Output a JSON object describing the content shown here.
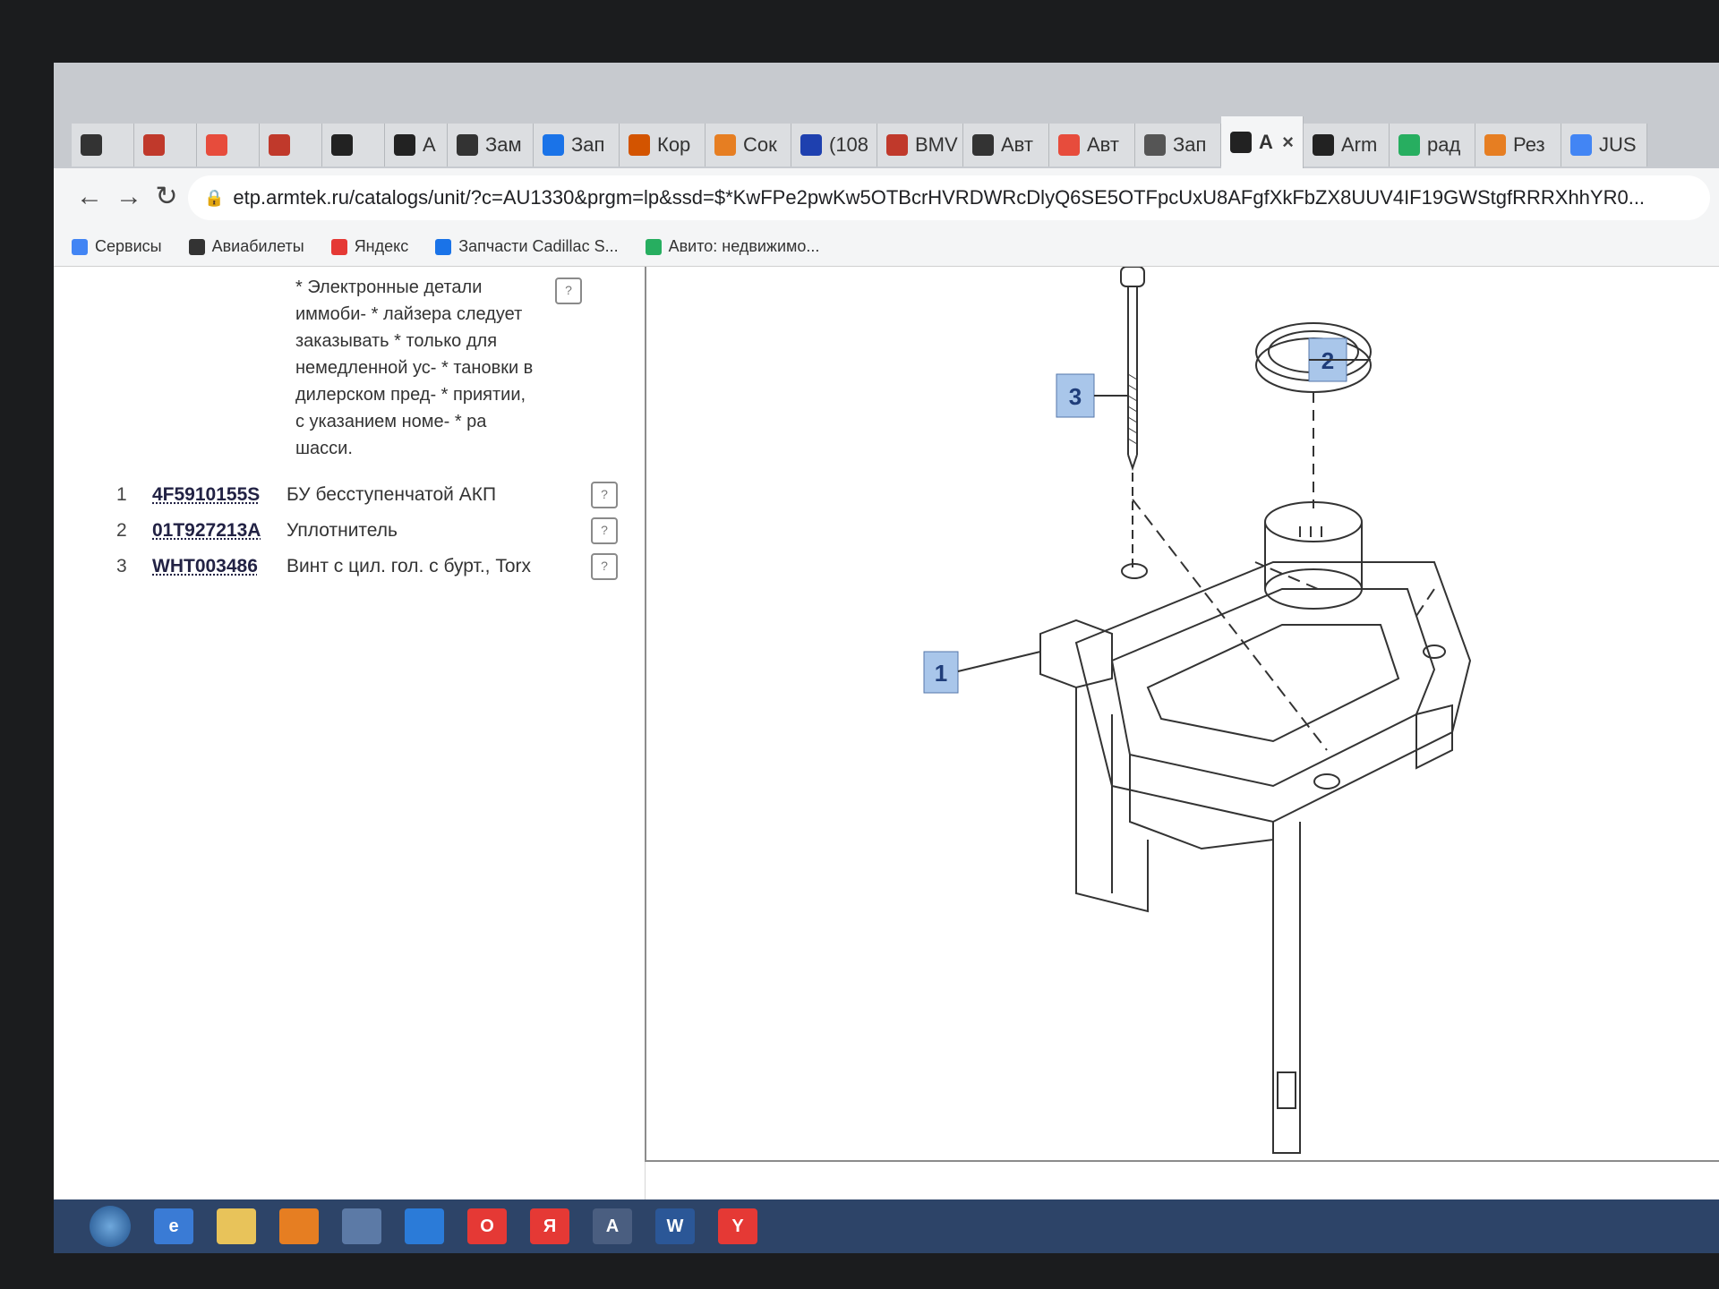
{
  "tabs": [
    {
      "label": "",
      "color": "#333"
    },
    {
      "label": "",
      "color": "#c0392b"
    },
    {
      "label": "",
      "color": "#e74c3c"
    },
    {
      "label": "",
      "color": "#c0392b"
    },
    {
      "label": "",
      "color": "#222"
    },
    {
      "label": "A",
      "color": "#222"
    },
    {
      "label": "Зам",
      "color": "#333"
    },
    {
      "label": "Зап",
      "color": "#1a73e8"
    },
    {
      "label": "Кор",
      "color": "#d35400"
    },
    {
      "label": "Сок",
      "color": "#e67e22"
    },
    {
      "label": "(108",
      "color": "#1e40af"
    },
    {
      "label": "BMV",
      "color": "#c0392b"
    },
    {
      "label": "Авт",
      "color": "#333"
    },
    {
      "label": "Авт",
      "color": "#e74c3c"
    },
    {
      "label": "Зап",
      "color": "#555"
    },
    {
      "label": "A",
      "color": "#222",
      "active": true
    },
    {
      "label": "Arm",
      "color": "#222"
    },
    {
      "label": "рад",
      "color": "#27ae60"
    },
    {
      "label": "Рез",
      "color": "#e67e22"
    },
    {
      "label": "JUS",
      "color": "#4285f4"
    }
  ],
  "address": {
    "url": "etp.armtek.ru/catalogs/unit/?c=AU1330&prgm=lp&ssd=$*KwFPe2pwKw5OTBcrHVRDWRcDlyQ6SE5OTFpcUxU8AFgfXkFbZX8UUV4IF19GWStgfRRRXhhYR0..."
  },
  "bookmarks": [
    {
      "label": "Сервисы",
      "color": "#4285f4"
    },
    {
      "label": "Авиабилеты",
      "color": "#333"
    },
    {
      "label": "Яндекс",
      "color": "#e53935"
    },
    {
      "label": "Запчасти Cadillac S...",
      "color": "#1a73e8"
    },
    {
      "label": "Авито: недвижимо...",
      "color": "#27ae60"
    }
  ],
  "note": {
    "text": "* Электронные детали иммоби- * лайзера следует заказывать * только для немедленной ус- * тановки в дилерском пред- * приятии, с указанием номе- * ра шасси."
  },
  "parts": [
    {
      "num": "1",
      "code": "4F5910155S",
      "name": "БУ бесступенчатой АКП"
    },
    {
      "num": "2",
      "code": "01T927213A",
      "name": "Уплотнитель"
    },
    {
      "num": "3",
      "code": "WHT003486",
      "name": "Винт с цил. гол. с бурт., Torx"
    }
  ],
  "callouts": [
    "1",
    "2",
    "3"
  ],
  "taskbar": {
    "icons": [
      {
        "name": "ie-icon",
        "label": "e",
        "color": "#3a7bd5"
      },
      {
        "name": "explorer-icon",
        "label": "",
        "color": "#e8c35a"
      },
      {
        "name": "media-icon",
        "label": "",
        "color": "#e67e22"
      },
      {
        "name": "chrome-icon",
        "label": "",
        "color": "#5c7aa6"
      },
      {
        "name": "app-icon",
        "label": "",
        "color": "#2b7bd8"
      },
      {
        "name": "opera-icon",
        "label": "O",
        "color": "#e53935"
      },
      {
        "name": "yandex-icon",
        "label": "Я",
        "color": "#e53935"
      },
      {
        "name": "autocad-icon",
        "label": "A",
        "color": "#4a5e80"
      },
      {
        "name": "word-icon",
        "label": "W",
        "color": "#2b5797"
      },
      {
        "name": "yandex-browser-icon",
        "label": "Y",
        "color": "#e53935"
      }
    ]
  }
}
